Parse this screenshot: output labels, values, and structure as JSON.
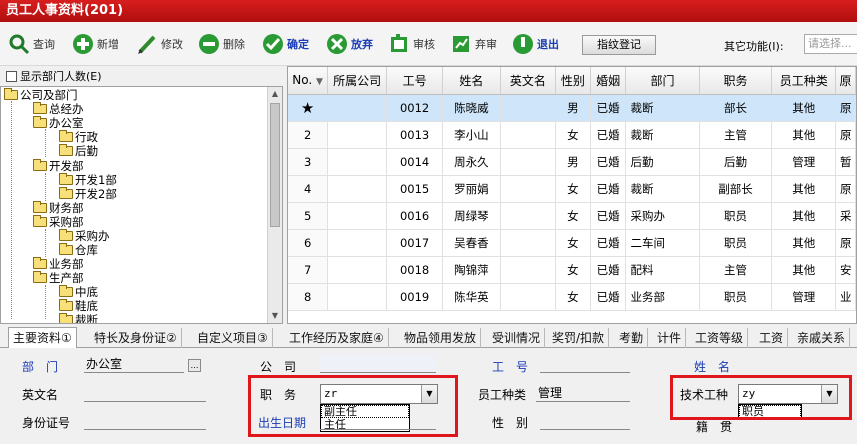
{
  "window": {
    "title": "员工人事资料(201)"
  },
  "toolbar": {
    "buttons": [
      {
        "label": "查询"
      },
      {
        "label": "新增"
      },
      {
        "label": "修改"
      },
      {
        "label": "删除"
      },
      {
        "label": "确定"
      },
      {
        "label": "放弃"
      },
      {
        "label": "审核"
      },
      {
        "label": "弃审"
      },
      {
        "label": "退出"
      }
    ],
    "fingerprint_label": "指纹登记",
    "other_label": "其它功能(I):",
    "other_placeholder": "请选择..."
  },
  "tree": {
    "show_count_label": "显示部门人数(E)",
    "nodes": [
      {
        "label": "公司及部门"
      },
      {
        "label": "总经办"
      },
      {
        "label": "办公室"
      },
      {
        "label": "行政"
      },
      {
        "label": "后勤"
      },
      {
        "label": "开发部"
      },
      {
        "label": "开发1部"
      },
      {
        "label": "开发2部"
      },
      {
        "label": "财务部"
      },
      {
        "label": "采购部"
      },
      {
        "label": "采购办"
      },
      {
        "label": "仓库"
      },
      {
        "label": "业务部"
      },
      {
        "label": "生产部"
      },
      {
        "label": "中底"
      },
      {
        "label": "鞋底"
      },
      {
        "label": "裁断"
      }
    ]
  },
  "grid": {
    "columns": [
      "No.",
      "所属公司",
      "工号",
      "姓名",
      "英文名",
      "性别",
      "婚姻",
      "部门",
      "职务",
      "员工种类",
      "原"
    ],
    "rows": [
      {
        "no": "★",
        "company": "",
        "id": "0012",
        "name": "陈晓威",
        "en": "",
        "sex": "男",
        "marital": "已婚",
        "dept": "裁断",
        "job": "部长",
        "type": "其他",
        "extra": "原"
      },
      {
        "no": "2",
        "company": "",
        "id": "0013",
        "name": "李小山",
        "en": "",
        "sex": "女",
        "marital": "已婚",
        "dept": "裁断",
        "job": "主管",
        "type": "其他",
        "extra": "原"
      },
      {
        "no": "3",
        "company": "",
        "id": "0014",
        "name": "周永久",
        "en": "",
        "sex": "男",
        "marital": "已婚",
        "dept": "后勤",
        "job": "后勤",
        "type": "管理",
        "extra": "暂"
      },
      {
        "no": "4",
        "company": "",
        "id": "0015",
        "name": "罗丽娟",
        "en": "",
        "sex": "女",
        "marital": "已婚",
        "dept": "裁断",
        "job": "副部长",
        "type": "其他",
        "extra": "原"
      },
      {
        "no": "5",
        "company": "",
        "id": "0016",
        "name": "周绿琴",
        "en": "",
        "sex": "女",
        "marital": "已婚",
        "dept": "采购办",
        "job": "职员",
        "type": "其他",
        "extra": "采"
      },
      {
        "no": "6",
        "company": "",
        "id": "0017",
        "name": "吴春香",
        "en": "",
        "sex": "女",
        "marital": "已婚",
        "dept": "二车间",
        "job": "职员",
        "type": "其他",
        "extra": "原"
      },
      {
        "no": "7",
        "company": "",
        "id": "0018",
        "name": "陶锦萍",
        "en": "",
        "sex": "女",
        "marital": "已婚",
        "dept": "配料",
        "job": "主管",
        "type": "其他",
        "extra": "安"
      },
      {
        "no": "8",
        "company": "",
        "id": "0019",
        "name": "陈华英",
        "en": "",
        "sex": "女",
        "marital": "已婚",
        "dept": "业务部",
        "job": "职员",
        "type": "管理",
        "extra": "业"
      }
    ]
  },
  "tabs": [
    {
      "label": "主要资料①"
    },
    {
      "label": "特长及身份证②"
    },
    {
      "label": "自定义项目③"
    },
    {
      "label": "工作经历及家庭④"
    },
    {
      "label": "物品领用发放"
    },
    {
      "label": "受训情况"
    },
    {
      "label": "奖罚/扣款"
    },
    {
      "label": "考勤"
    },
    {
      "label": "计件"
    },
    {
      "label": "工资等级"
    },
    {
      "label": "工资"
    },
    {
      "label": "亲戚关系"
    }
  ],
  "form": {
    "dept_label": "部　门",
    "dept_value": "办公室",
    "company_label": "公　司",
    "id_label": "工　号",
    "name_label": "姓　名",
    "en_label": "英文名",
    "job_label": "职　务",
    "job_value": "zr",
    "job_options": [
      "副主任",
      "主任"
    ],
    "type_label": "员工种类",
    "type_value": "管理",
    "tech_label": "技术工种",
    "tech_value": "zy",
    "tech_options": [
      "职员"
    ],
    "idcard_label": "身份证号",
    "birth_label": "出生日期",
    "sex_label": "性　别",
    "origin_label": "籍　贯"
  }
}
